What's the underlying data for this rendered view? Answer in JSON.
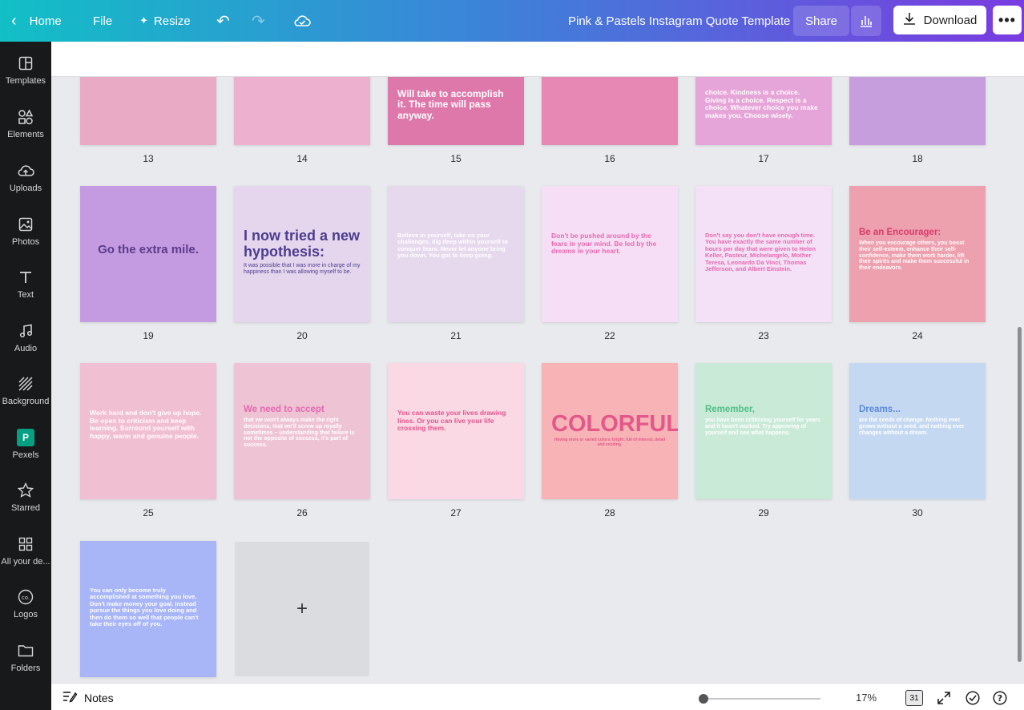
{
  "topbar": {
    "home_label": "Home",
    "file_label": "File",
    "resize_label": "Resize",
    "doc_title": "Pink & Pastels Instagram Quote Template",
    "share_label": "Share",
    "download_label": "Download",
    "more_label": "•••"
  },
  "sidebar": {
    "items": [
      {
        "label": "Templates"
      },
      {
        "label": "Elements"
      },
      {
        "label": "Uploads"
      },
      {
        "label": "Photos"
      },
      {
        "label": "Text"
      },
      {
        "label": "Audio"
      },
      {
        "label": "Background"
      },
      {
        "label": "Pexels"
      },
      {
        "label": "Starred"
      },
      {
        "label": "All your de..."
      },
      {
        "label": "Logos"
      },
      {
        "label": "Folders"
      }
    ]
  },
  "pages": [
    {
      "num": "13",
      "bg": "#e8aac4",
      "q": "",
      "color": "#ffffff"
    },
    {
      "num": "14",
      "bg": "#eeb0cf",
      "q": "",
      "color": "#ffffff"
    },
    {
      "num": "15",
      "bg": "#df78aa",
      "q": "Will take to accomplish it. The time will pass anyway.",
      "color": "#ffffff"
    },
    {
      "num": "16",
      "bg": "#e787b4",
      "q": "",
      "color": "#ffffff"
    },
    {
      "num": "17",
      "bg": "#e6a5d8",
      "q": "choice. Kindness is a choice. Giving is a choice. Respect is a choice. Whatever choice you make makes you. Choose wisely.",
      "color": "#ffffff"
    },
    {
      "num": "18",
      "bg": "#c69ede",
      "q": "",
      "color": "#ffffff"
    },
    {
      "num": "19",
      "bg": "#c49be0",
      "q": "Go the extra mile.",
      "color": "#5a3b8c",
      "accent": "#ffffff"
    },
    {
      "num": "20",
      "bg": "#e5d6ee",
      "q": "I now tried a new hypothesis:",
      "color": "#4b3d8e",
      "sub": "It was possible that I was more in charge of my happiness than I was allowing myself to be."
    },
    {
      "num": "21",
      "bg": "#e6d9ee",
      "q": "Believe in yourself, take on your challenges, dig deep within yourself to conquer fears. Never let anyone bring you down. You got to keep going.",
      "color": "#ffffff"
    },
    {
      "num": "22",
      "bg": "#f7def7",
      "q": "Don't be pushed around by the fears in your mind. Be led by the dreams in your heart.",
      "color": "#e46ab0"
    },
    {
      "num": "23",
      "bg": "#f5e1f7",
      "q": "Don't say you don't have enough time. You have exactly the same number of hours per day that were given to Helen Keller, Pasteur, Michelangelo, Mother Teresa, Leonardo Da Vinci, Thomas Jefferson, and Albert Einstein.",
      "color": "#e46ab0"
    },
    {
      "num": "24",
      "bg": "#eda0ae",
      "q": "Be an Encourager:",
      "color": "#d93a6a",
      "sub": "When you encourage others, you boost their self-esteem, enhance their self-confidence, make them work harder, lift their spirits and make them successful in their endeavors."
    },
    {
      "num": "25",
      "bg": "#f1bfd2",
      "q": "Work hard and don't give up hope. Be open to criticism and keep learning. Surround yourself with happy, warm and genuine people.",
      "color": "#ffffff"
    },
    {
      "num": "26",
      "bg": "#eec3d3",
      "q": "We need to accept",
      "color": "#e46ab0",
      "sub": "that we won't always make the right decisions, that we'll screw up royally sometimes – understanding that failure is not the opposite of success, it's part of success."
    },
    {
      "num": "27",
      "bg": "#fad8e4",
      "q": "You can waste your lives drawing lines. Or you can live your life crossing them.",
      "color": "#e1558f"
    },
    {
      "num": "28",
      "bg": "#f8b3b6",
      "q": "COLORFUL",
      "color": "#e3588a",
      "sub": "Having more or varied colors; bright; full of interest, detail and exciting."
    },
    {
      "num": "29",
      "bg": "#c9ead7",
      "q": "Remember,",
      "color": "#4fc086",
      "sub": "you have been criticizing yourself for years and it hasn't worked. Try approving of yourself and see what happens."
    },
    {
      "num": "30",
      "bg": "#c5d8f2",
      "q": "Dreams...",
      "color": "#5b8ad8",
      "sub": "are the seeds of change. Nothing ever grows without a seed, and nothing ever changes without a dream."
    },
    {
      "num": "",
      "bg": "#a8b5f7",
      "q": "You can only become truly accomplished at something you love. Don't make money your goal. Instead pursue the things you love doing and then do them so well that people can't take their eyes off of you.",
      "color": "#ffffff"
    }
  ],
  "add_page_icon": "+",
  "bottombar": {
    "notes_label": "Notes",
    "zoom": "17%",
    "zoom_fraction": 0.04,
    "page_count": "31"
  },
  "colors": {
    "topbar_start": "#12bfc6",
    "topbar_end": "#7a3be0",
    "sidebar_bg": "#18191b",
    "canvas_bg": "#e8eaed"
  }
}
